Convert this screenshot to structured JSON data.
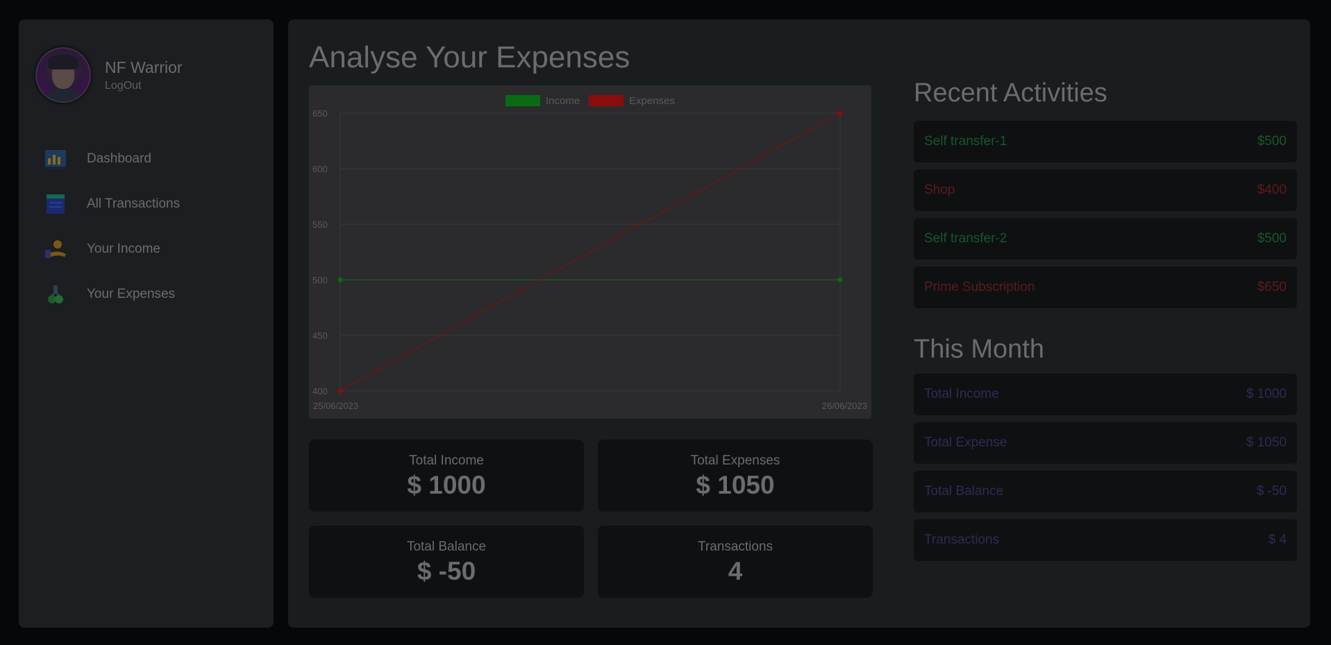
{
  "profile": {
    "name": "NF Warrior",
    "logout_label": "LogOut"
  },
  "nav": [
    {
      "label": "Dashboard",
      "icon": "dashboard-icon"
    },
    {
      "label": "All Transactions",
      "icon": "transactions-icon"
    },
    {
      "label": "Your Income",
      "icon": "income-icon"
    },
    {
      "label": "Your Expenses",
      "icon": "expenses-icon"
    }
  ],
  "page_title": "Analyse Your Expenses",
  "colors": {
    "income": "#0b6b13",
    "expense": "#8a0d0d",
    "income_text": "#14592c",
    "expense_text": "#5e1a1a",
    "month_text": "#2f2a55"
  },
  "chart_data": {
    "type": "line",
    "x": [
      "25/06/2023",
      "26/06/2023"
    ],
    "series": [
      {
        "name": "Income",
        "values": [
          500,
          500
        ],
        "color": "#0b6b13"
      },
      {
        "name": "Expenses",
        "values": [
          400,
          650
        ],
        "color": "#8a0d0d"
      }
    ],
    "yticks": [
      400,
      450,
      500,
      550,
      600,
      650
    ],
    "ylim": [
      400,
      650
    ],
    "grid": true,
    "legend": "top"
  },
  "stats": {
    "income": {
      "label": "Total Income",
      "value": "$ 1000"
    },
    "expenses": {
      "label": "Total Expenses",
      "value": "$ 1050"
    },
    "balance": {
      "label": "Total Balance",
      "value": "$ -50"
    },
    "transactions": {
      "label": "Transactions",
      "value": "4"
    }
  },
  "recent": {
    "title": "Recent Activities",
    "items": [
      {
        "name": "Self transfer-1",
        "amount": "$500",
        "type": "income"
      },
      {
        "name": "Shop",
        "amount": "$400",
        "type": "expense"
      },
      {
        "name": "Self transfer-2",
        "amount": "$500",
        "type": "income"
      },
      {
        "name": "Prime Subscription",
        "amount": "$650",
        "type": "expense"
      }
    ]
  },
  "month": {
    "title": "This Month",
    "items": [
      {
        "name": "Total Income",
        "value": "$ 1000"
      },
      {
        "name": "Total Expense",
        "value": "$ 1050"
      },
      {
        "name": "Total Balance",
        "value": "$ -50"
      },
      {
        "name": "Transactions",
        "value": "$ 4"
      }
    ]
  }
}
